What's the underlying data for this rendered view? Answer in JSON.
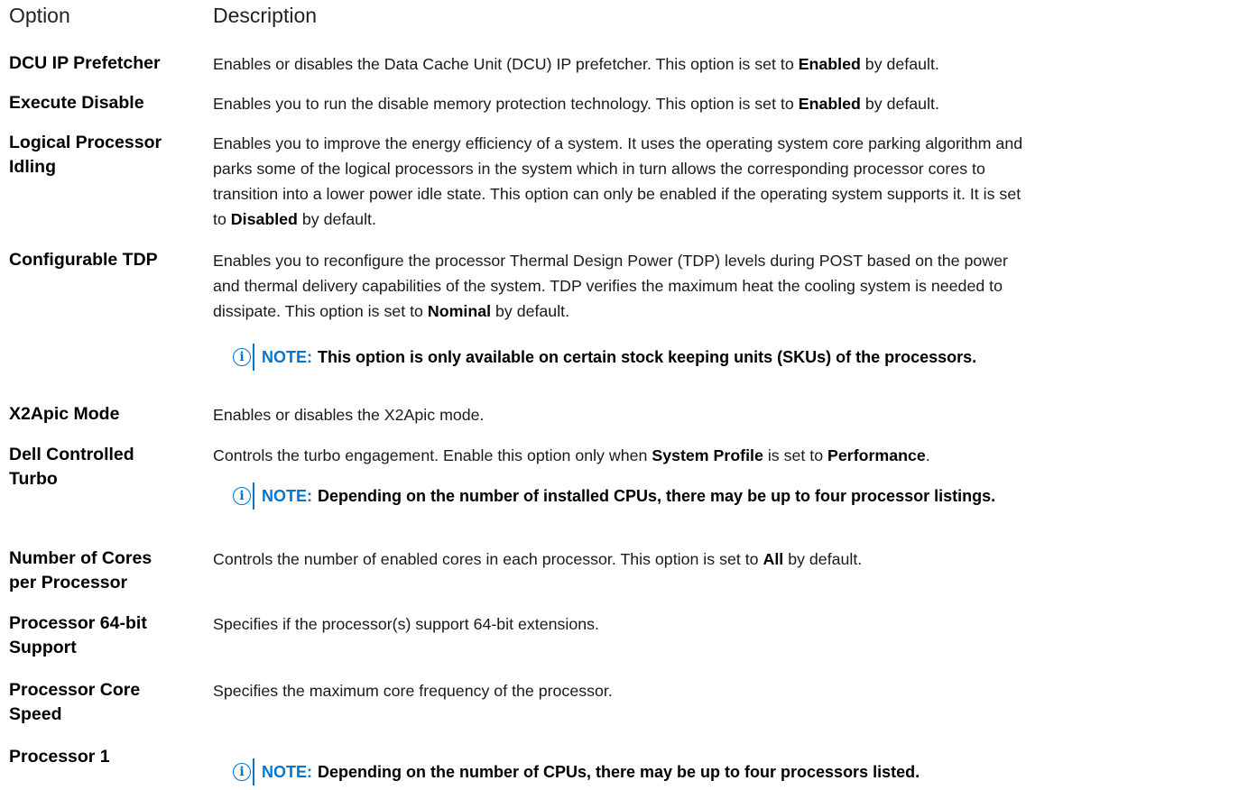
{
  "header": {
    "option": "Option",
    "description": "Description"
  },
  "rows": [
    {
      "name": "DCU IP Prefetcher",
      "d": [
        "Enables or disables the Data Cache Unit (DCU) IP prefetcher. This option is set to ",
        "Enabled",
        " by default."
      ]
    },
    {
      "name": "Execute Disable",
      "d": [
        "Enables you to run the disable memory protection technology. This option is set to ",
        "Enabled",
        " by default."
      ]
    },
    {
      "name1": "Logical Processor",
      "name2": "Idling",
      "l1": "Enables you to improve the energy efficiency of a system. It uses the operating system core parking algorithm and",
      "l2": "parks some of the logical processors in the system which in turn allows the corresponding processor cores to",
      "l3": "transition into a lower power idle state. This option can only be enabled if the operating system supports it. It is set",
      "l4": [
        "to ",
        "Disabled",
        " by default."
      ]
    },
    {
      "name": "Configurable TDP",
      "l1": "Enables you to reconfigure the processor Thermal Design Power (TDP) levels during POST based on the power",
      "l2": "and thermal delivery capabilities of the system. TDP verifies the maximum heat the cooling system is needed to",
      "l3": [
        "dissipate. This option is set to ",
        "Nominal",
        " by default."
      ],
      "note": "This option is only available on certain stock keeping units (SKUs) of the processors."
    },
    {
      "name": "X2Apic Mode",
      "d": "Enables or disables the X2Apic mode."
    },
    {
      "name1": "Dell Controlled",
      "name2": "Turbo",
      "d": [
        "Controls the turbo engagement. Enable this option only when ",
        "System Profile",
        " is set to ",
        "Performance",
        "."
      ],
      "note": "Depending on the number of installed CPUs, there may be up to four processor listings."
    },
    {
      "name1": "Number of Cores",
      "name2": "per Processor",
      "d": [
        "Controls the number of enabled cores in each processor. This option is set to ",
        "All",
        " by default."
      ]
    },
    {
      "name1": "Processor 64-bit",
      "name2": "Support",
      "d": "Specifies if the processor(s) support 64-bit extensions."
    },
    {
      "name1": "Processor Core",
      "name2": "Speed",
      "d": "Specifies the maximum core frequency of the processor."
    },
    {
      "name": "Processor 1",
      "note": "Depending on the number of CPUs, there may be up to four processors listed."
    }
  ],
  "note_label": "NOTE:",
  "note_icon": "info-circle-icon",
  "accent_color": "#0076ce"
}
